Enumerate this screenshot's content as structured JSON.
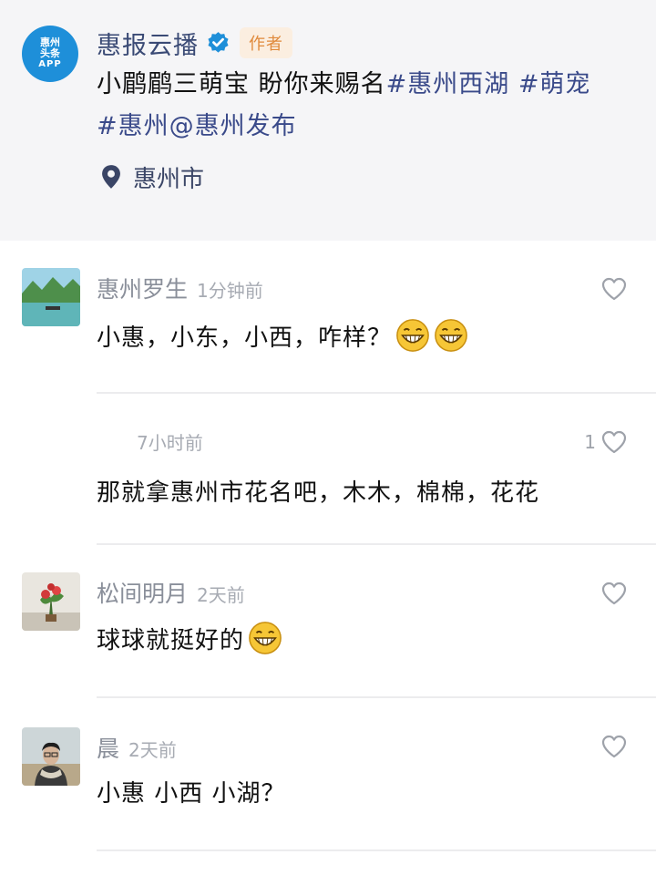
{
  "post": {
    "author": {
      "avatar_lines": [
        "惠州",
        "头条",
        "APP"
      ],
      "name": "惠报云播",
      "badge": "作者"
    },
    "text_plain": "小鹛鹛三萌宝  盼你来赐名",
    "tags": [
      "#惠州西湖",
      "#萌宠",
      "#惠州",
      "@惠州发布"
    ],
    "location": "惠州市"
  },
  "comments": [
    {
      "name": "惠州罗生",
      "time": "1分钟前",
      "text": "小惠，小东，小西，咋样？",
      "emojis": [
        "grin-emoji",
        "grin-emoji"
      ],
      "likes": ""
    },
    {
      "name": "",
      "time": "7小时前",
      "text": "那就拿惠州市花名吧，木木，棉棉，花花",
      "emojis": [],
      "likes": "1"
    },
    {
      "name": "松间明月",
      "time": "2天前",
      "text": "球球就挺好的",
      "emojis": [
        "grin-emoji"
      ],
      "likes": ""
    },
    {
      "name": "晨",
      "time": "2天前",
      "text": "小惠 小西 小湖？",
      "emojis": [],
      "likes": ""
    }
  ],
  "colors": {
    "post_background": "#f5f5f7",
    "username": "#8a8f9a",
    "tag": "#3a4a8a",
    "badge_text": "#e08a3c",
    "badge_bg": "#fbeee0",
    "verified": "#1e8fd9"
  },
  "icons": {
    "verified": "verified-badge-icon",
    "location": "location-pin-icon",
    "like": "heart-outline-icon"
  }
}
